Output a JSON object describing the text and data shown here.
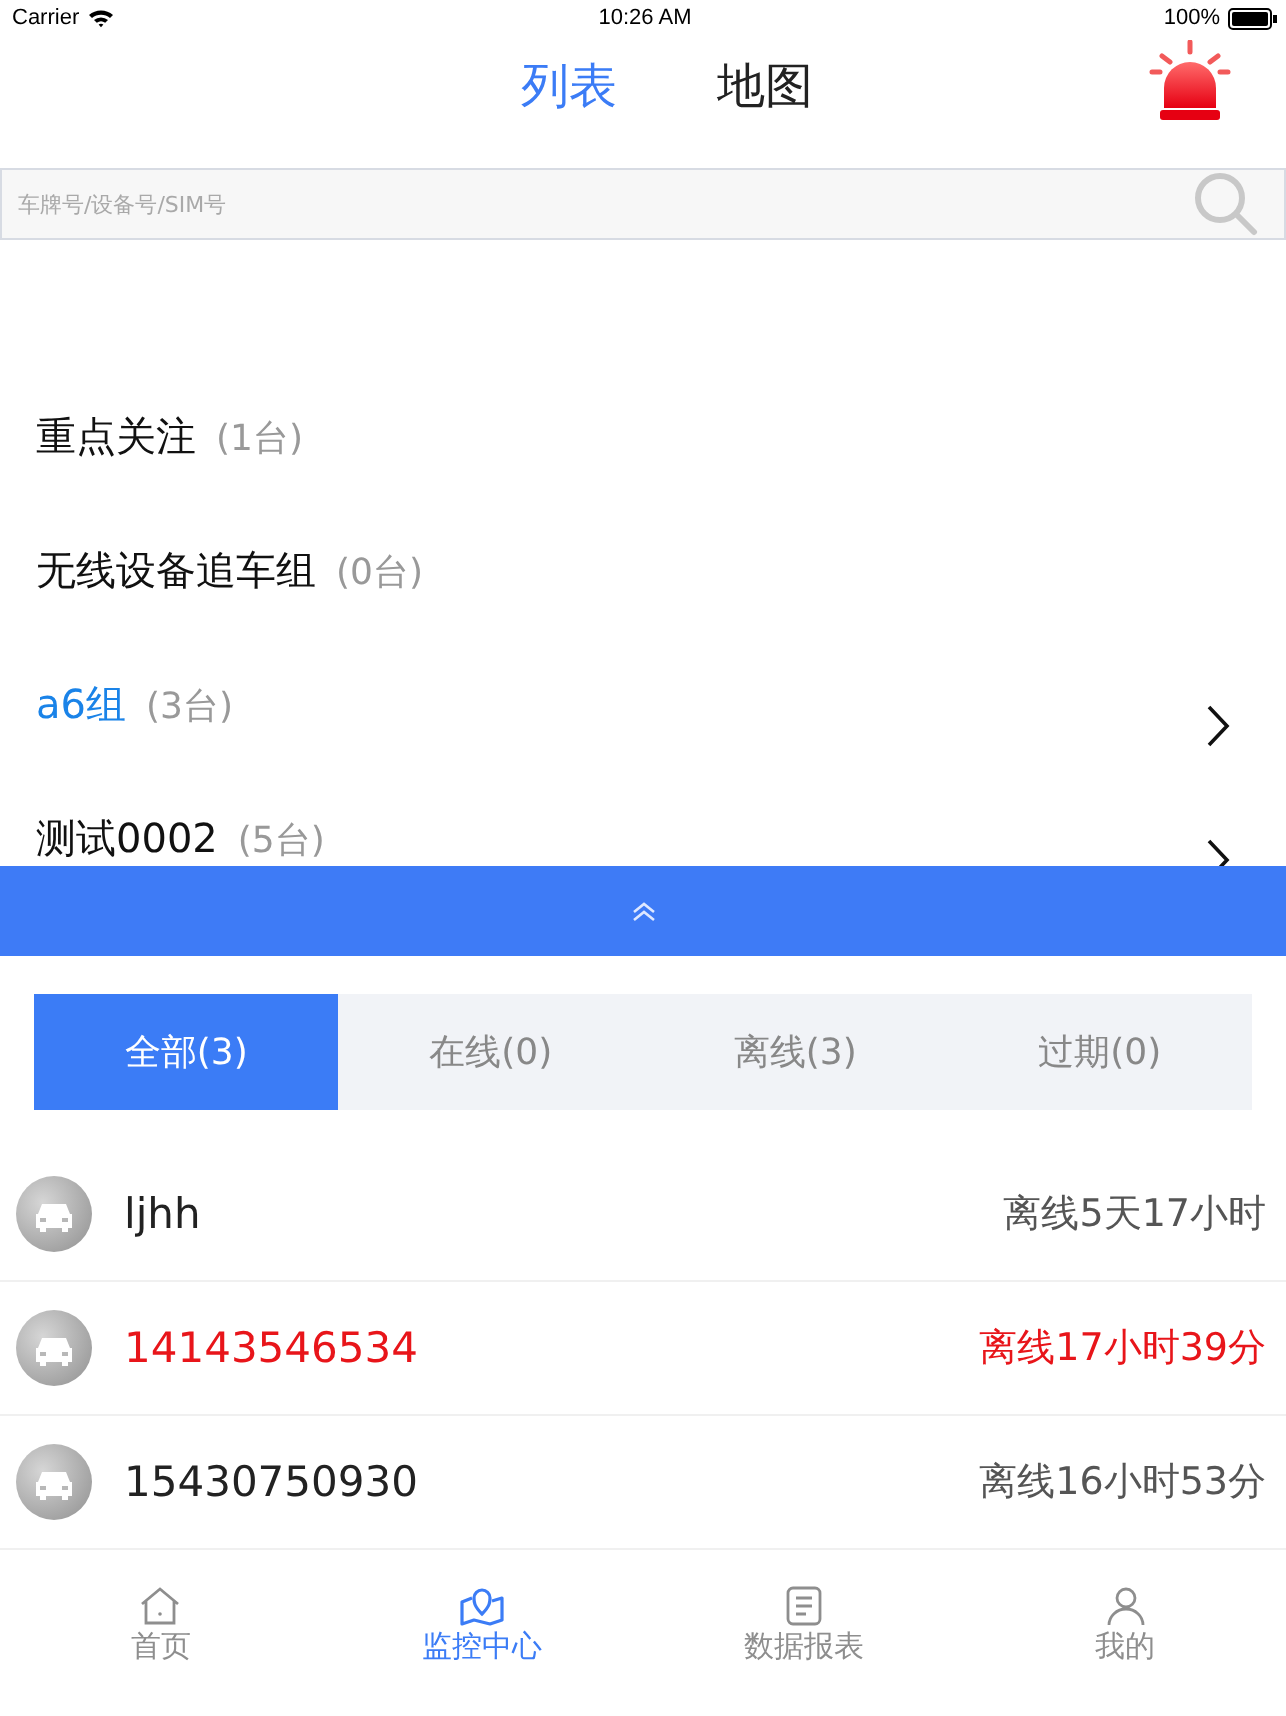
{
  "status_bar": {
    "carrier": "Carrier",
    "time": "10:26 AM",
    "battery": "100%"
  },
  "header_tabs": [
    {
      "label": "列表",
      "selected": true
    },
    {
      "label": "地图",
      "selected": false
    }
  ],
  "search": {
    "placeholder": "车牌号/设备号/SIM号"
  },
  "groups": [
    {
      "name": "重点关注",
      "count": "(1台)",
      "selected": false,
      "has_arrow": false
    },
    {
      "name": "无线设备追车组",
      "count": "(0台)",
      "selected": false,
      "has_arrow": false
    },
    {
      "name": "a6组",
      "count": "(3台)",
      "selected": true,
      "has_arrow": true
    },
    {
      "name": "测试0002",
      "count": "(5台)",
      "selected": false,
      "has_arrow": true
    }
  ],
  "filter_tabs": [
    {
      "label": "全部(3)",
      "selected": true
    },
    {
      "label": "在线(0)",
      "selected": false
    },
    {
      "label": "离线(3)",
      "selected": false
    },
    {
      "label": "过期(0)",
      "selected": false
    }
  ],
  "vehicles": [
    {
      "name": "ljhh",
      "status": "离线5天17小时",
      "alert": false
    },
    {
      "name": "14143546534",
      "status": "离线17小时39分",
      "alert": true
    },
    {
      "name": "15430750930",
      "status": "离线16小时53分",
      "alert": false
    }
  ],
  "bottom_nav": [
    {
      "label": "首页",
      "kind": "home",
      "selected": false
    },
    {
      "label": "监控中心",
      "kind": "monitor",
      "selected": true
    },
    {
      "label": "数据报表",
      "kind": "report",
      "selected": false
    },
    {
      "label": "我的",
      "kind": "profile",
      "selected": false
    }
  ]
}
